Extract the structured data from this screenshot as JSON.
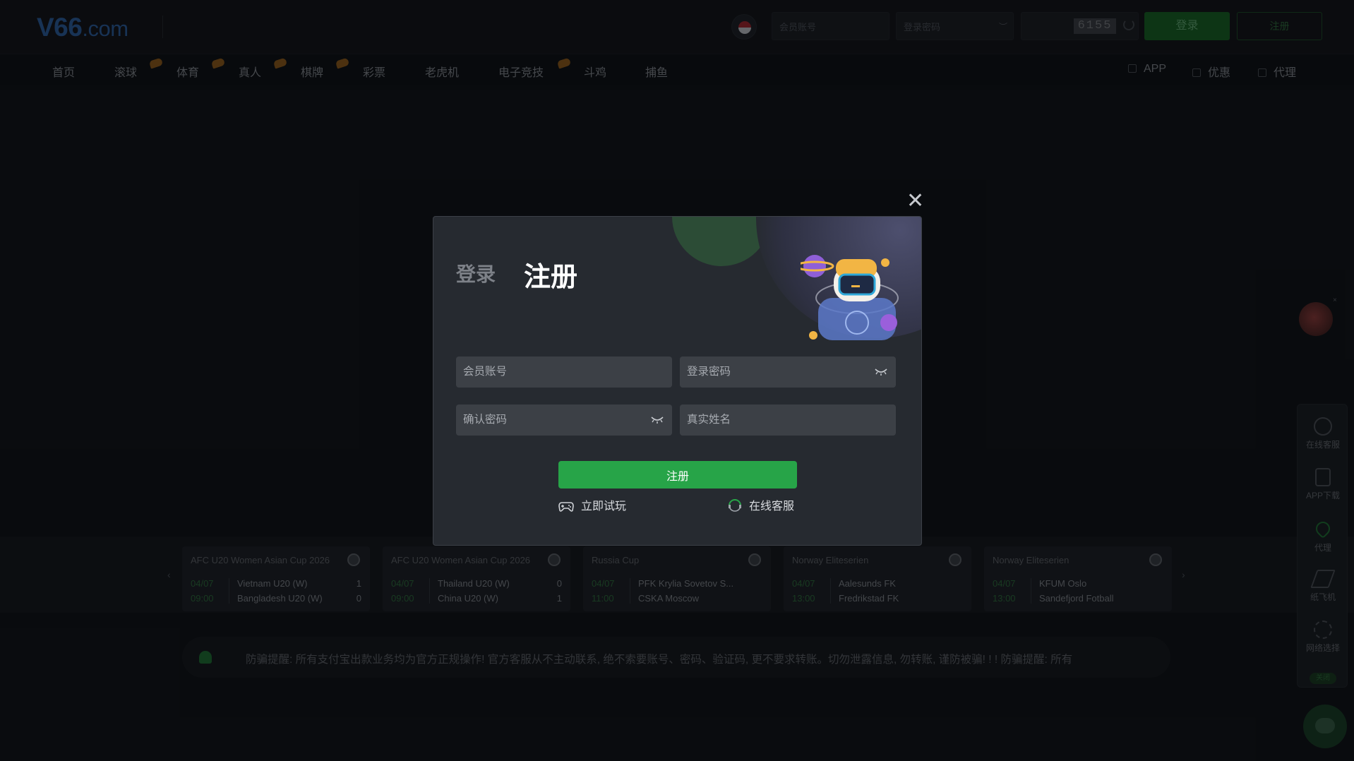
{
  "header": {
    "logo_main": "V66",
    "logo_tld": ".com",
    "username_placeholder": "会员账号",
    "password_placeholder": "登录密码",
    "captcha": "6155",
    "login_label": "登录",
    "register_label": "注册"
  },
  "nav": {
    "items": [
      "首页",
      "滚球",
      "体育",
      "真人",
      "棋牌",
      "彩票",
      "老虎机",
      "电子竞技",
      "斗鸡",
      "捕鱼"
    ],
    "right": [
      "APP",
      "优惠",
      "代理"
    ]
  },
  "modal": {
    "tab_login": "登录",
    "tab_register": "注册",
    "fields": {
      "username": "会员账号",
      "password": "登录密码",
      "confirm_password": "确认密码",
      "real_name": "真实姓名"
    },
    "submit": "注册",
    "trial": "立即试玩",
    "support": "在线客服"
  },
  "matches": [
    {
      "league": "AFC U20 Women Asian Cup 2026",
      "date": "04/07",
      "time": "09:00",
      "team1": "Vietnam U20 (W)",
      "team2": "Bangladesh U20 (W)",
      "score1": "1",
      "score2": "0"
    },
    {
      "league": "AFC U20 Women Asian Cup 2026",
      "date": "04/07",
      "time": "09:00",
      "team1": "Thailand U20 (W)",
      "team2": "China U20 (W)",
      "score1": "0",
      "score2": "1"
    },
    {
      "league": "Russia Cup",
      "date": "04/07",
      "time": "11:00",
      "team1": "PFK Krylia Sovetov S...",
      "team2": "CSKA Moscow",
      "score1": "",
      "score2": ""
    },
    {
      "league": "Norway Eliteserien",
      "date": "04/07",
      "time": "13:00",
      "team1": "Aalesunds FK",
      "team2": "Fredrikstad FK",
      "score1": "",
      "score2": ""
    },
    {
      "league": "Norway Eliteserien",
      "date": "04/07",
      "time": "13:00",
      "team1": "KFUM Oslo",
      "team2": "Sandefjord Fotball",
      "score1": "",
      "score2": ""
    }
  ],
  "notice": "防骗提醒: 所有支付宝出款业务均为官方正规操作! 官方客服从不主动联系, 绝不索要账号、密码、验证码, 更不要求转账。切勿泄露信息, 勿转账, 谨防被骗! ! !      防骗提醒: 所有",
  "side_panel": {
    "items": [
      "在线客服",
      "APP下载",
      "代理",
      "纸飞机",
      "网络选择"
    ],
    "toggle": "关闭"
  },
  "colors": {
    "accent_green": "#27a448",
    "background": "#12151b",
    "modal_bg": "#262a30"
  }
}
